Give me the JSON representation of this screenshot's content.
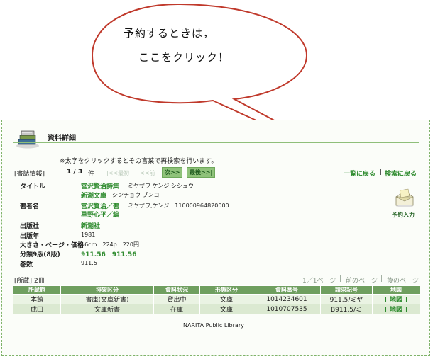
{
  "callout": {
    "line1": "予約するときは，",
    "line2": "ここをクリック！"
  },
  "header": {
    "title": "資料詳細",
    "icon": "books-icon"
  },
  "notice": "※太字をクリックするとその言葉で再検索を行います。",
  "record_nav": {
    "section_label": "[書誌情報]",
    "position": "1 / 3",
    "unit": "件",
    "first": "|<<最初",
    "prev": "<<前",
    "next": "次>>",
    "last": "最後>>|",
    "back_to_list": "一覧に戻る",
    "separator": "|",
    "back_to_search": "検索に戻る"
  },
  "fields": {
    "title_label": "タイトル",
    "title_value": "宮沢賢治詩集",
    "title_kana": "ミヤザワ ケンジ シシュウ",
    "series_value": "新潮文庫",
    "series_kana": "シンチョウ ブンコ",
    "author_label": "著者名",
    "author1": "宮沢賢治／著",
    "author1_kana": "ミヤザワ,ケンジ　110000964820000",
    "author2": "草野心平／編",
    "publisher_label": "出版社",
    "publisher_value": "新潮社",
    "year_label": "出版年",
    "year_value": "1981",
    "size_label": "大きさ・ページ・価格",
    "size_value": "16cm　224p　220円",
    "ndc_label": "分類9版(8版)",
    "ndc_value": "911.56　911.56",
    "volume_label": "巻数",
    "volume_value": "911.5"
  },
  "reserve": {
    "label": "予約入力",
    "icon": "envelope-icon"
  },
  "holdings": {
    "section_label": "[所蔵]",
    "count": "2冊",
    "pager_text": "1／1ページ",
    "prev_page": "前のページ",
    "next_page": "後のページ",
    "sep": "|",
    "columns": [
      "所蔵館",
      "排架区分",
      "資料状況",
      "形態区分",
      "資料番号",
      "請求記号",
      "地図"
    ],
    "rows": [
      [
        "本館",
        "書庫(文庫新書)",
        "貸出中",
        "文庫",
        "1014234601",
        "911.5/ミヤ",
        "[ 地図 ]"
      ],
      [
        "成田",
        "文庫新書",
        "在庫",
        "文庫",
        "1010707535",
        "B911.5/ミ",
        "[ 地図 ]"
      ]
    ]
  },
  "footer": "NARITA Public Library",
  "colors": {
    "accent_green": "#2e8b2e",
    "header_bg": "#6f9f5f",
    "bubble_stroke": "#c0392b"
  }
}
